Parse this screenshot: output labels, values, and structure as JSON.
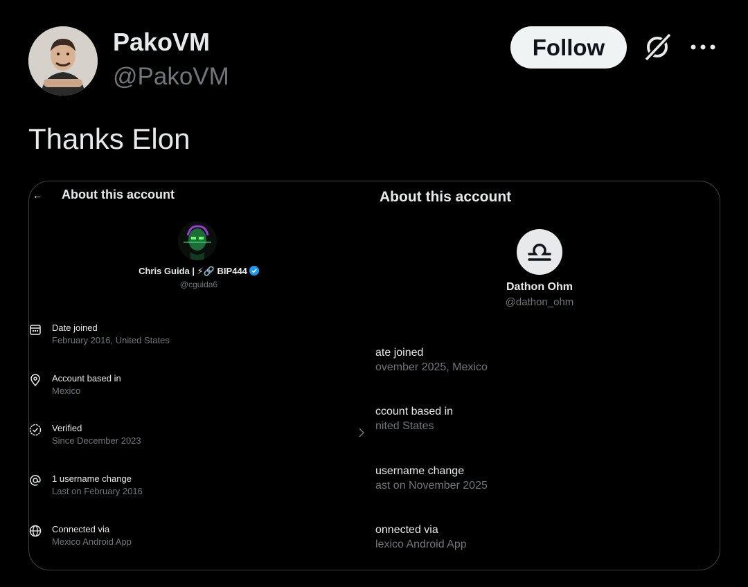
{
  "post": {
    "author_name": "PakoVM",
    "author_handle": "@PakoVM",
    "follow_label": "Follow",
    "text": "Thanks Elon"
  },
  "icons": {
    "grok": "grok-icon",
    "more": "more-icon"
  },
  "colors": {
    "background": "#000000",
    "text_primary": "#e7e9ea",
    "text_secondary": "#71767b",
    "follow_bg": "#eff3f4",
    "verified": "#1d9bf0"
  },
  "left_screenshot": {
    "title": "About this account",
    "name": "Chris Guida | ⚡🔗 BIP444",
    "handle": "@cguida6",
    "rows": [
      {
        "icon": "calendar-icon",
        "label": "Date joined",
        "value": "February 2016, United States"
      },
      {
        "icon": "location-pin-icon",
        "label": "Account based in",
        "value": "Mexico"
      },
      {
        "icon": "verified-check-icon",
        "label": "Verified",
        "value": "Since December 2023"
      },
      {
        "icon": "at-sign-icon",
        "label": "1 username change",
        "value": "Last on February 2016"
      },
      {
        "icon": "globe-icon",
        "label": "Connected via",
        "value": "Mexico Android App"
      }
    ]
  },
  "right_screenshot": {
    "title": "About this account",
    "name": "Dathon Ohm",
    "handle": "@dathon_ohm",
    "rows": [
      {
        "label": "ate joined",
        "value": "ovember 2025, Mexico"
      },
      {
        "label": "ccount based in",
        "value": "nited States"
      },
      {
        "label": "username change",
        "value": "ast on November 2025"
      },
      {
        "label": "onnected via",
        "value": "lexico Android App"
      }
    ]
  }
}
